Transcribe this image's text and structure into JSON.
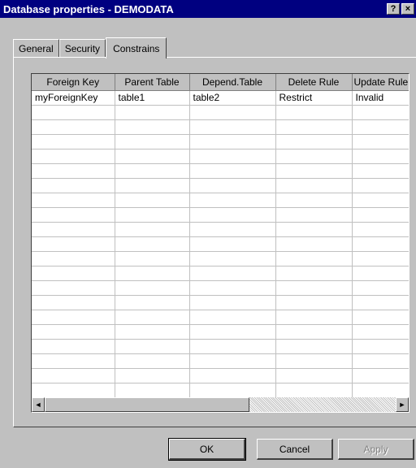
{
  "window": {
    "title": "Database properties - DEMODATA",
    "help_button": "?",
    "close_button": "×"
  },
  "tabs": [
    {
      "label": "General",
      "active": false
    },
    {
      "label": "Security",
      "active": false
    },
    {
      "label": "Constrains",
      "active": true
    }
  ],
  "table": {
    "columns": [
      "Foreign Key",
      "Parent Table",
      "Depend.Table",
      "Delete Rule",
      "Update Rule"
    ],
    "rows": [
      [
        "myForeignKey",
        "table1",
        "table2",
        "Restrict",
        "Invalid"
      ]
    ],
    "empty_rows": 20
  },
  "scrollbar": {
    "left_arrow": "◄",
    "right_arrow": "►"
  },
  "buttons": {
    "ok": "OK",
    "cancel": "Cancel",
    "apply": "Apply"
  }
}
